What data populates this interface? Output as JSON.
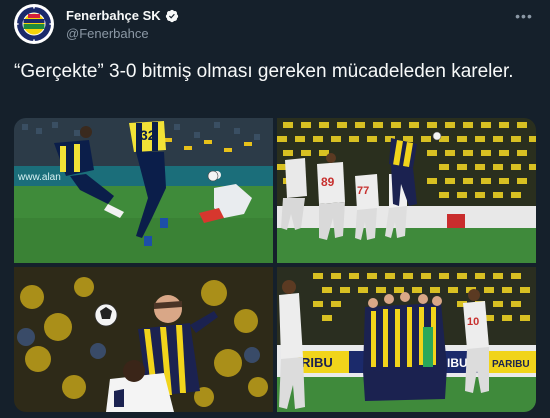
{
  "tweet": {
    "display_name": "Fenerbahçe SK",
    "handle": "@Fenerbahce",
    "text": "“Gerçekte” 3-0 bitmiş olması gereken mücadeleden kareler.",
    "more_icon": "more-horizontal-icon",
    "verified_icon": "verified-badge-icon"
  },
  "avatar": {
    "logo_text": "FENERBAHÇE SPOR KULÜBÜ 1907",
    "colors": {
      "navy": "#1b2a6b",
      "yellow": "#f5d30a",
      "red": "#d3203b",
      "green": "#1e8a3c"
    }
  },
  "photos": [
    {
      "name": "photo-1",
      "banner_text": "www.alan",
      "shirt_number": "32",
      "jersey_colors": [
        "#0b1e4a",
        "#f2e236"
      ]
    },
    {
      "name": "photo-2",
      "shirt_numbers": [
        "89",
        "77"
      ],
      "jersey_colors": [
        "#e8e8e8",
        "#1b2250",
        "#f1d41b"
      ]
    },
    {
      "name": "photo-3",
      "jersey_colors": [
        "#1b2250",
        "#f1d41b",
        "#f4f4f4"
      ]
    },
    {
      "name": "photo-4",
      "banner_texts": [
        "RIBU",
        "IBU",
        "PARIBU"
      ],
      "shirt_number": "10",
      "jersey_colors": [
        "#e8e8e8",
        "#1b2250",
        "#f1d41b"
      ]
    }
  ],
  "colors": {
    "background": "#15202b",
    "text_primary": "#f7f9f9",
    "text_secondary": "#8b98a5",
    "verified": "#1d9bf0"
  }
}
